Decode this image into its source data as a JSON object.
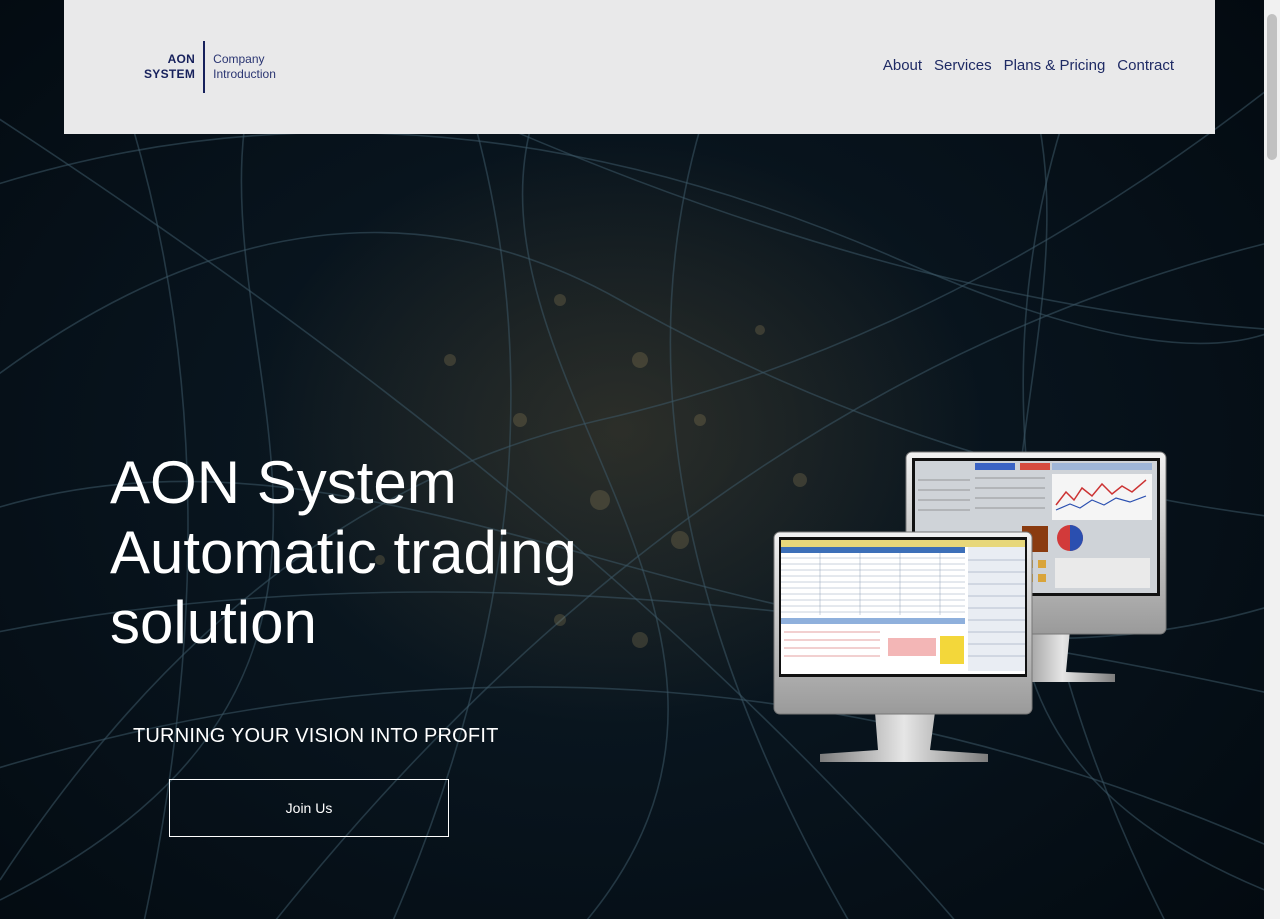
{
  "header": {
    "logo_line1": "AON",
    "logo_line2": "SYSTEM",
    "logo_sub1": "Company",
    "logo_sub2": "Introduction",
    "nav": [
      "About",
      "Services",
      "Plans & Pricing",
      "Contract"
    ]
  },
  "hero": {
    "title_lines": [
      "AON System",
      "Automatic trading",
      "solution"
    ],
    "tagline": "TURNING YOUR VISION INTO PROFIT",
    "cta_label": "Join Us"
  },
  "colors": {
    "header_bg": "#e9e9ea",
    "brand_navy": "#17215c",
    "hero_text": "#ffffff",
    "background": "#06111a"
  },
  "icons": {
    "illustration": "trading-monitors-illustration"
  }
}
